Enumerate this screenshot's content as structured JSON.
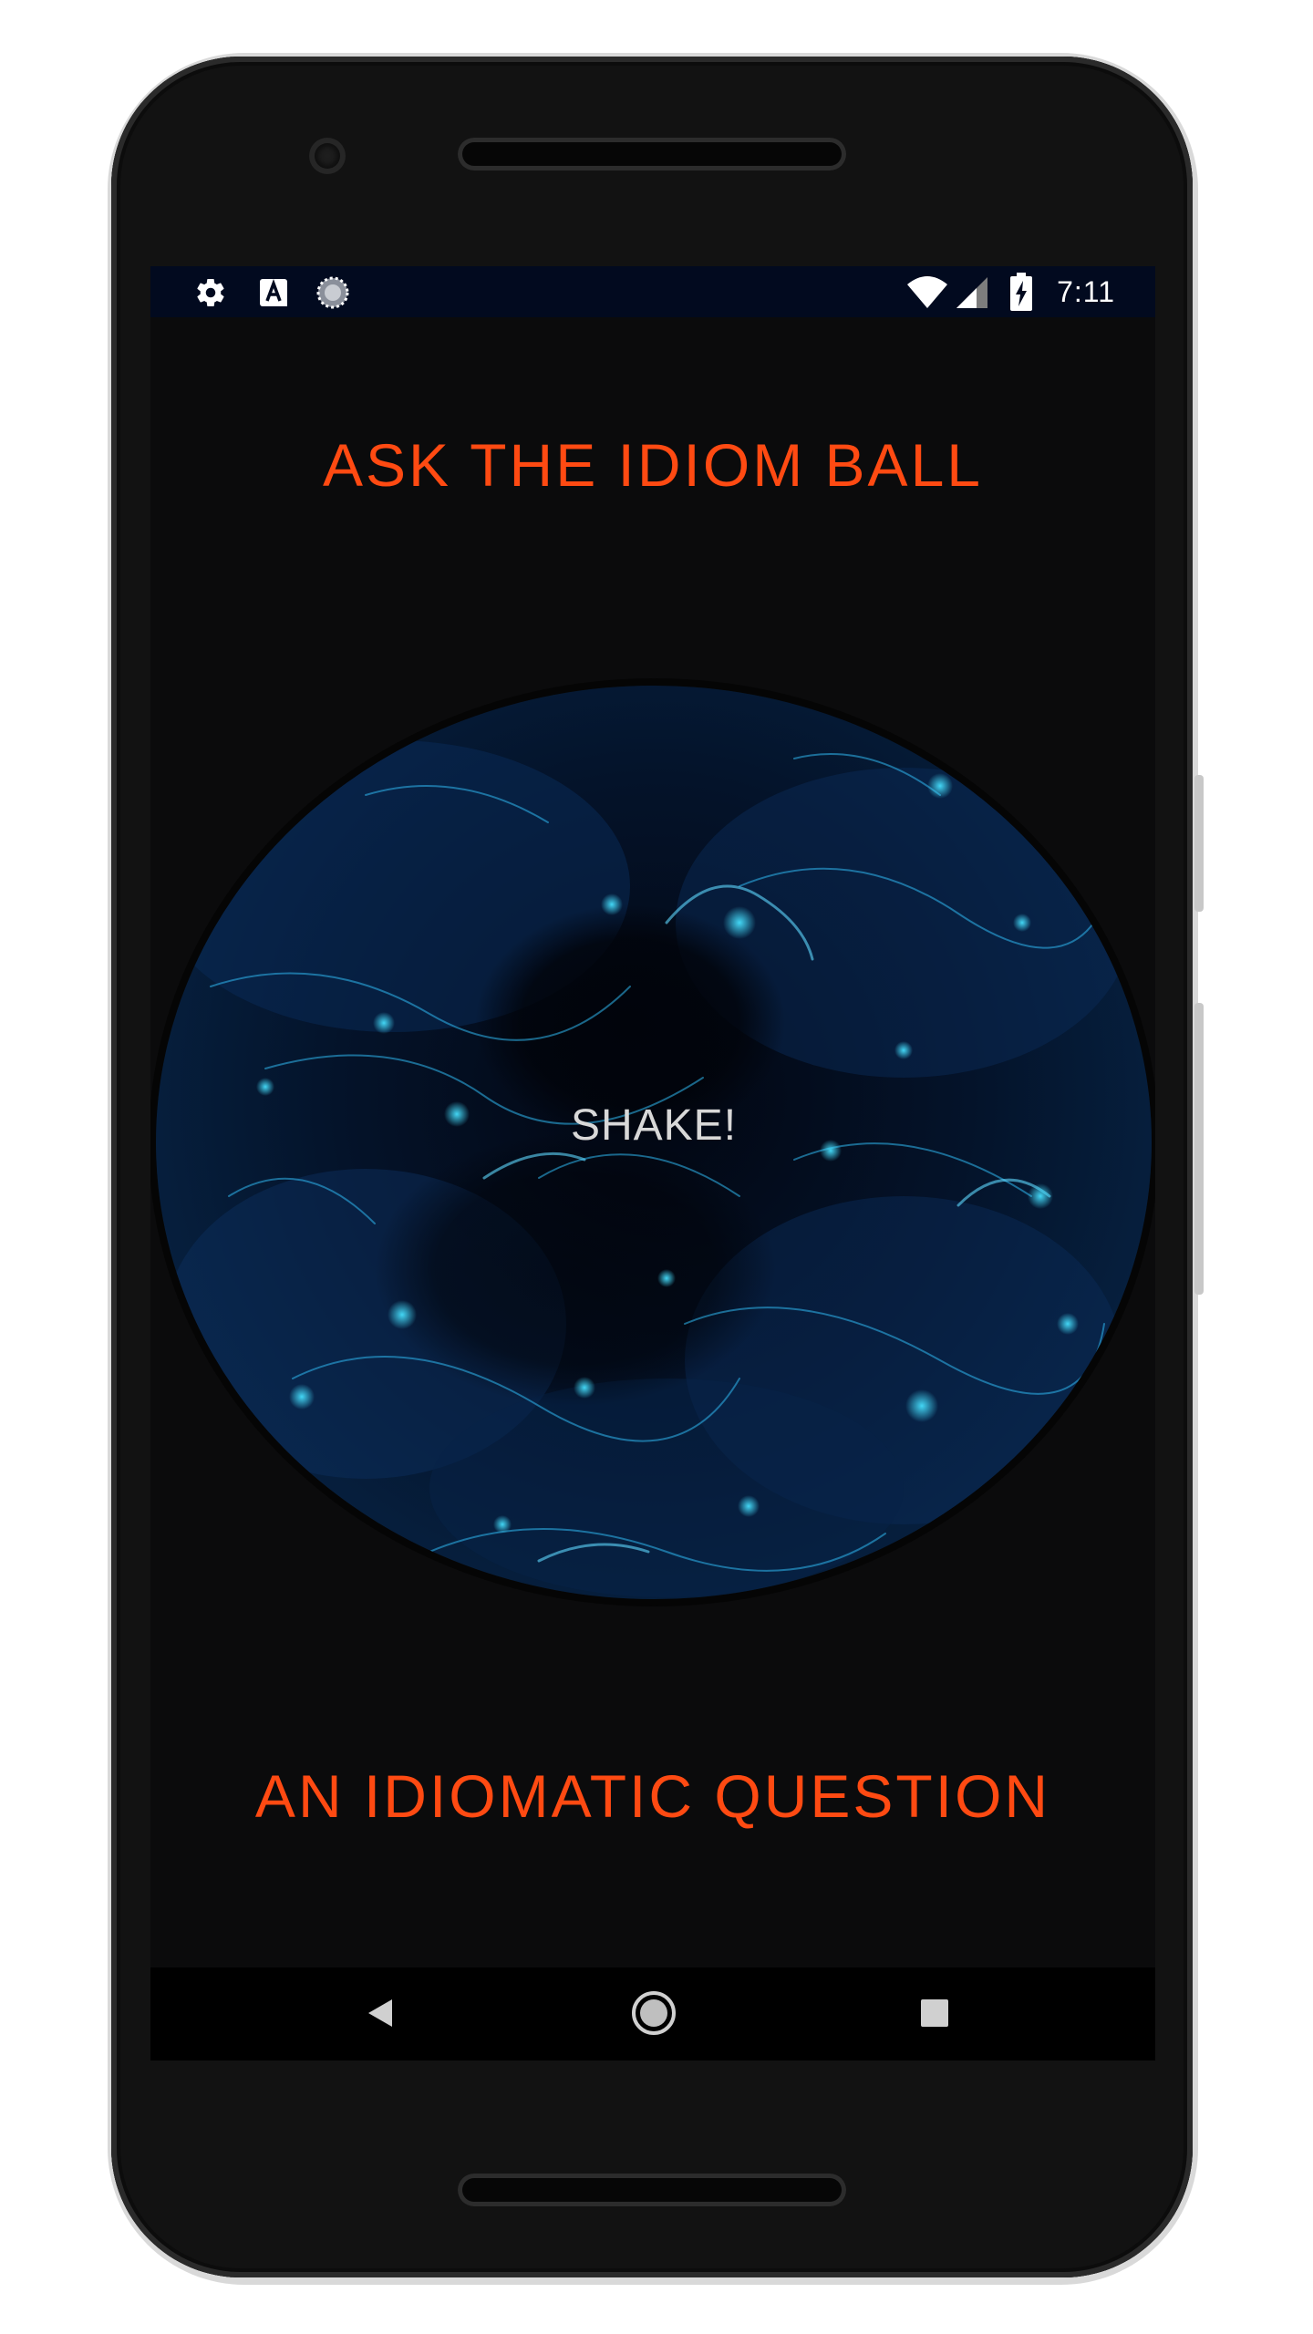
{
  "status_bar": {
    "icons": [
      "settings-icon",
      "keyboard-a-icon",
      "loading-circle-icon",
      "wifi-icon",
      "cell-signal-icon",
      "battery-charging-icon"
    ],
    "time": "7:11"
  },
  "app": {
    "title": "ASK THE IDIOM BALL",
    "ball_label": "SHAKE!",
    "question": "AN IDIOMATIC QUESTION"
  },
  "nav_bar": {
    "icons": [
      "back-triangle-icon",
      "home-circle-icon",
      "recents-square-icon"
    ]
  },
  "colors": {
    "accent": "#ff4a12",
    "background": "#0b0b0c",
    "status_bar": "#020a1f",
    "ball_glow": "#35d0ff"
  }
}
